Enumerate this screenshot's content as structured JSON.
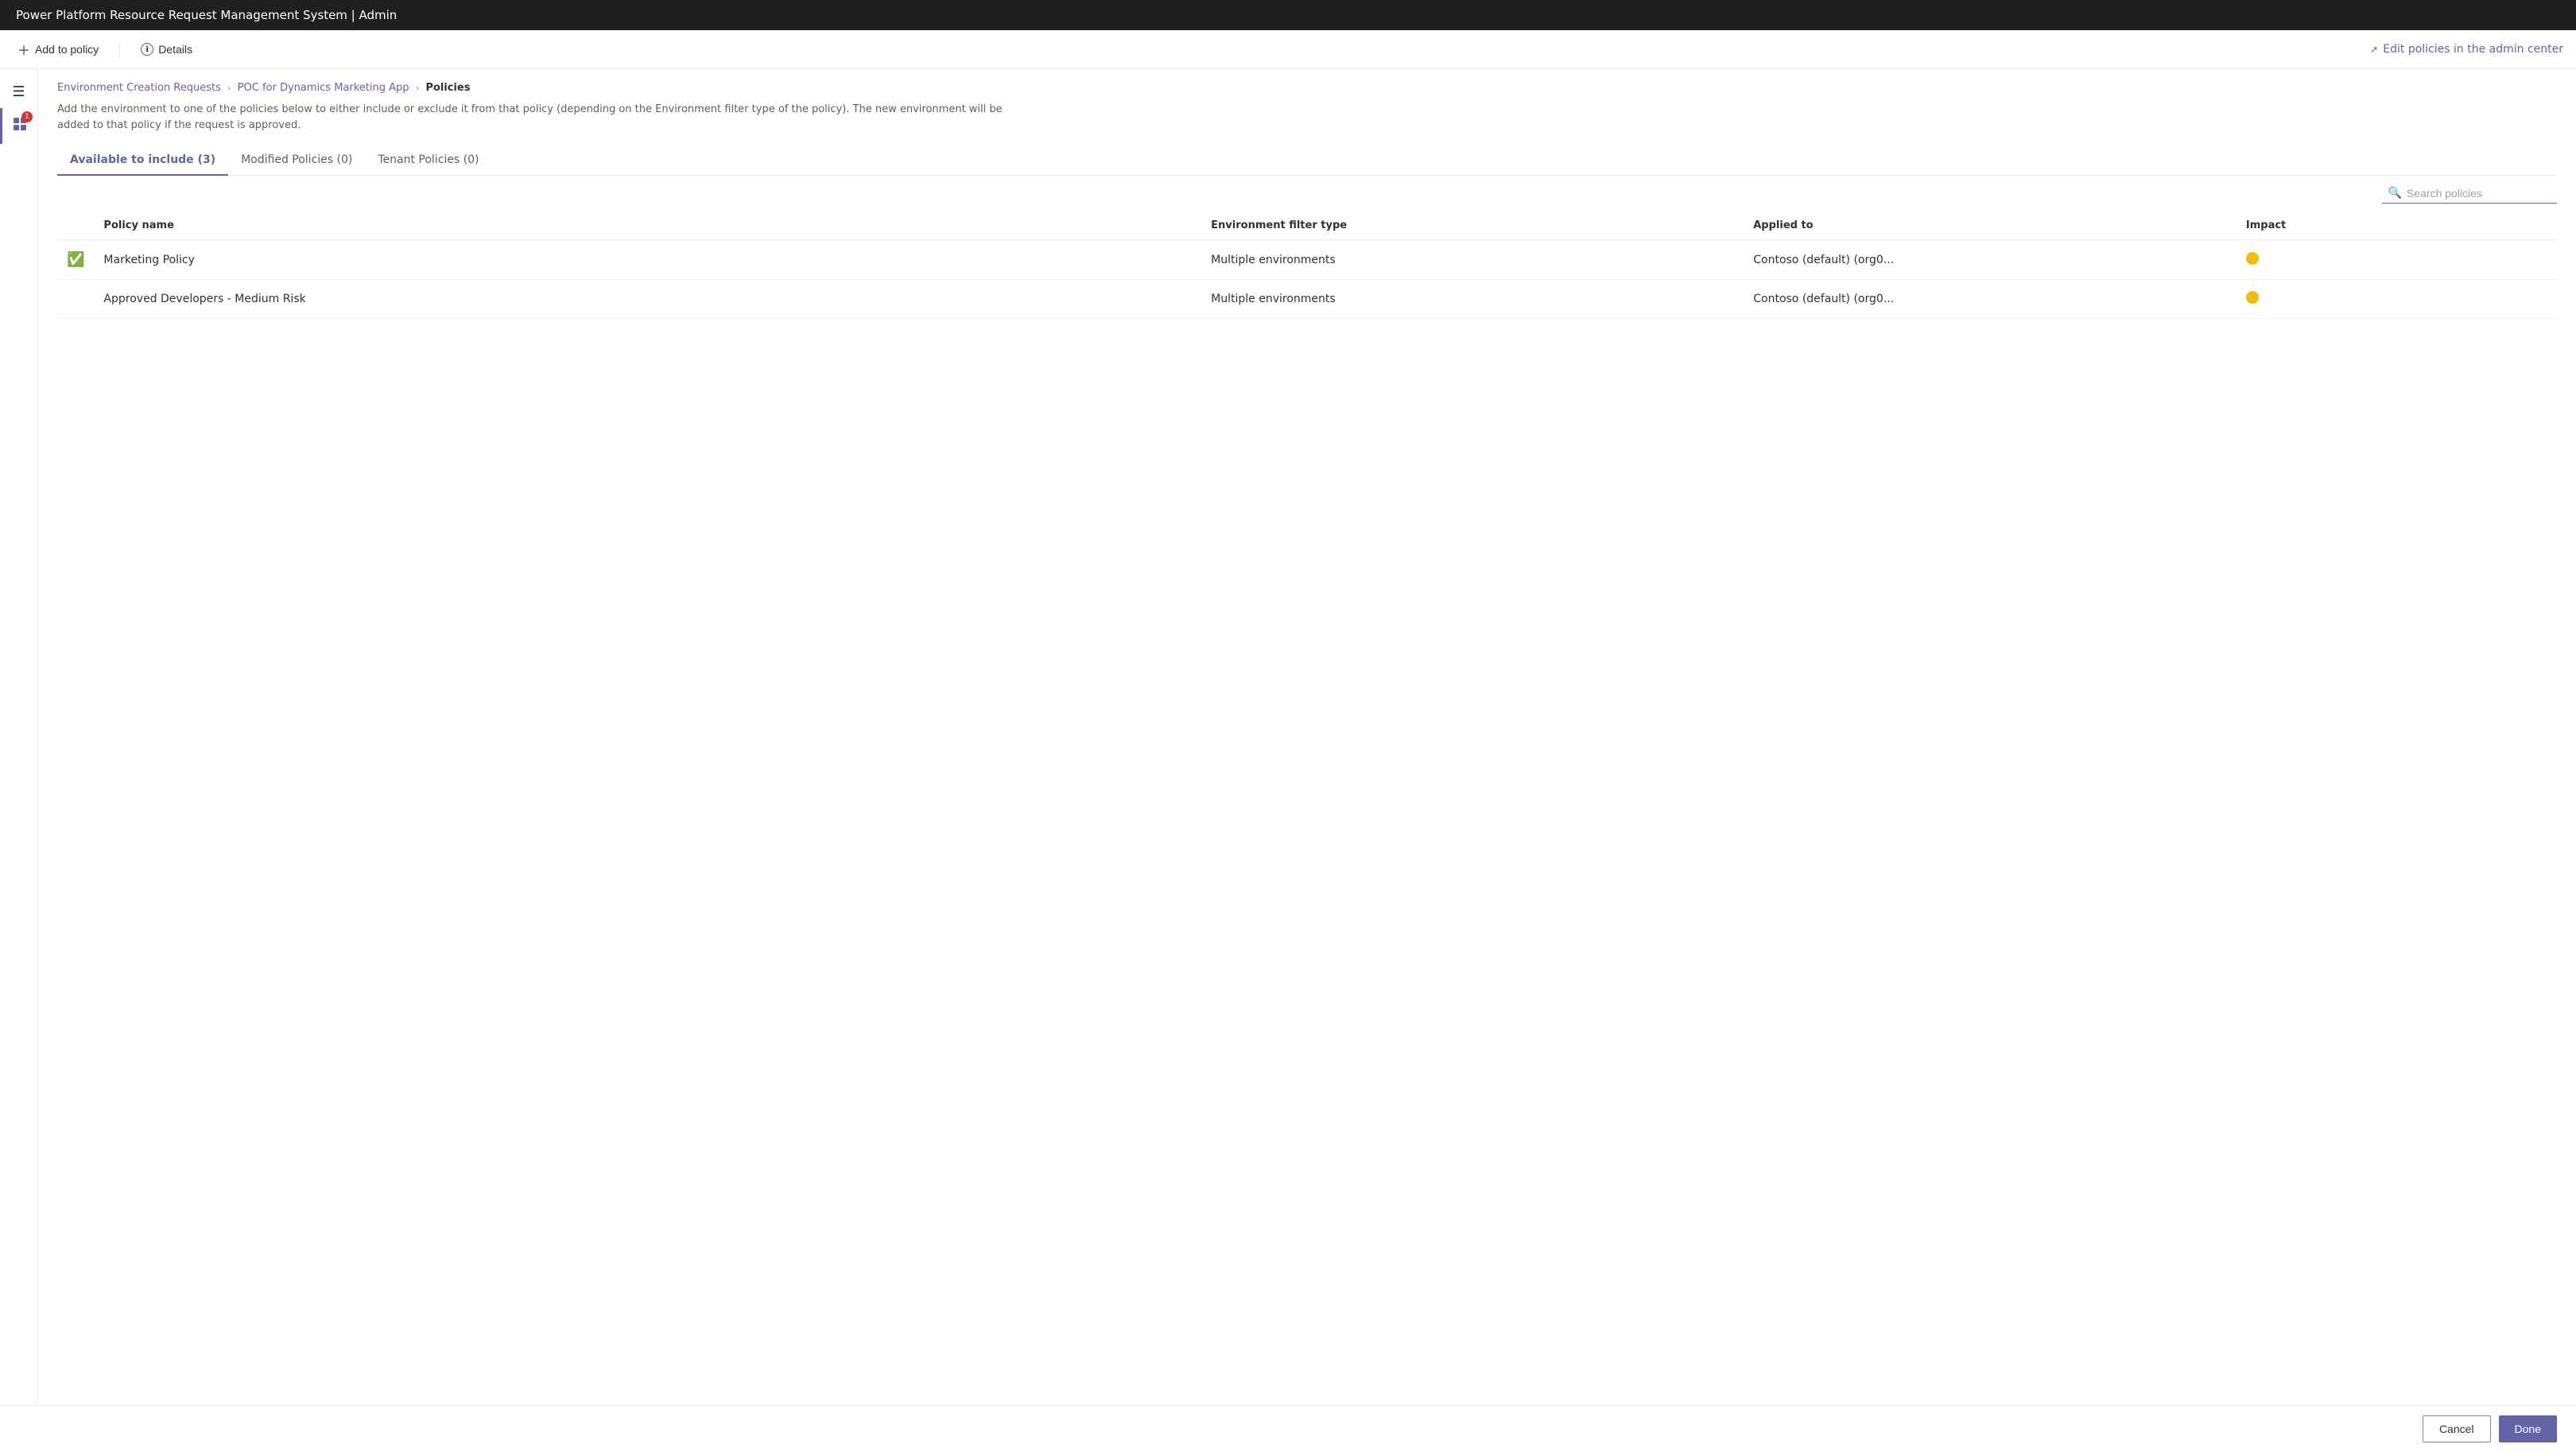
{
  "titleBar": {
    "title": "Power Platform Resource Request Management System | Admin"
  },
  "toolbar": {
    "addToPolicyLabel": "Add to policy",
    "detailsLabel": "Details",
    "editPoliciesLabel": "Edit policies in the admin center"
  },
  "breadcrumb": {
    "step1": "Environment Creation Requests",
    "step2": "POC for Dynamics Marketing App",
    "step3": "Policies"
  },
  "description": "Add the environment to one of the policies below to either include or exclude it from that policy (depending on the Environment filter type of the policy). The new environment will be added to that policy if the request is approved.",
  "tabs": [
    {
      "label": "Available to include (3)",
      "active": true
    },
    {
      "label": "Modified Policies (0)",
      "active": false
    },
    {
      "label": "Tenant Policies (0)",
      "active": false
    }
  ],
  "search": {
    "placeholder": "Search policies"
  },
  "table": {
    "columns": [
      {
        "key": "name",
        "label": "Policy name"
      },
      {
        "key": "filterType",
        "label": "Environment filter type"
      },
      {
        "key": "appliedTo",
        "label": "Applied to"
      },
      {
        "key": "impact",
        "label": "Impact"
      }
    ],
    "rows": [
      {
        "selected": true,
        "name": "Marketing Policy",
        "filterType": "Multiple environments",
        "appliedTo": "Contoso (default) (org0...",
        "impactColor": "#f0c000"
      },
      {
        "selected": false,
        "name": "Approved Developers - Medium Risk",
        "filterType": "Multiple environments",
        "appliedTo": "Contoso (default) (org0...",
        "impactColor": "#f0c000"
      }
    ]
  },
  "footer": {
    "cancelLabel": "Cancel",
    "doneLabel": "Done"
  }
}
